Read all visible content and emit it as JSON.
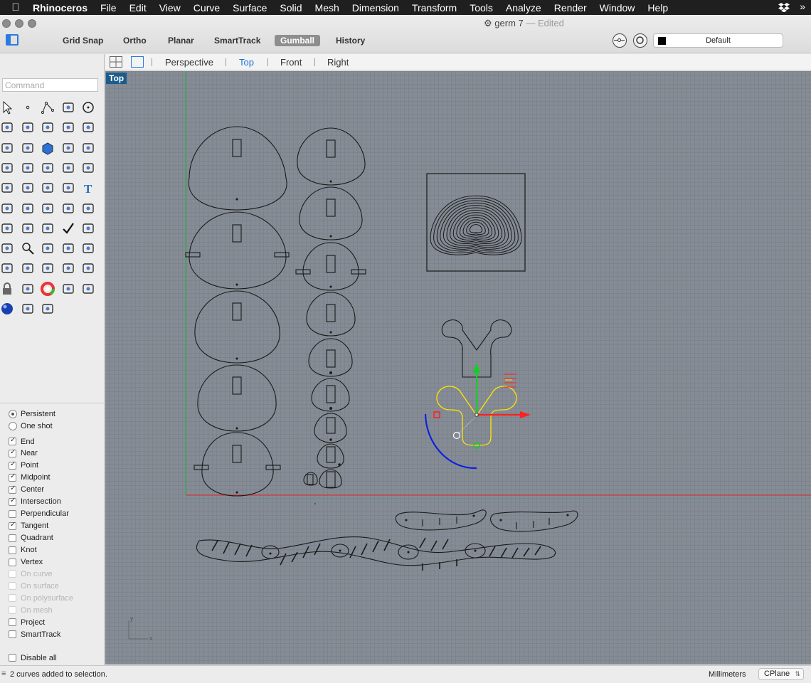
{
  "menubar": {
    "app": "Rhinoceros",
    "items": [
      "File",
      "Edit",
      "View",
      "Curve",
      "Surface",
      "Solid",
      "Mesh",
      "Dimension",
      "Transform",
      "Tools",
      "Analyze",
      "Render",
      "Window",
      "Help"
    ]
  },
  "window": {
    "title": "germ 7",
    "edited": "— Edited"
  },
  "toolbar": {
    "modes": [
      {
        "label": "Grid Snap",
        "active": false
      },
      {
        "label": "Ortho",
        "active": false
      },
      {
        "label": "Planar",
        "active": false
      },
      {
        "label": "SmartTrack",
        "active": false
      },
      {
        "label": "Gumball",
        "active": true
      },
      {
        "label": "History",
        "active": false
      }
    ],
    "layer": "Default"
  },
  "viewtabs": {
    "tabs": [
      "Perspective",
      "Top",
      "Front",
      "Right"
    ],
    "active": "Top"
  },
  "command": {
    "placeholder": "Command"
  },
  "viewport": {
    "label": "Top",
    "axis_x": "x",
    "axis_y": "y"
  },
  "osnap": {
    "modes": [
      {
        "label": "Persistent",
        "type": "radio",
        "on": true
      },
      {
        "label": "One shot",
        "type": "radio",
        "on": false
      }
    ],
    "items": [
      {
        "label": "End",
        "on": true,
        "enabled": true
      },
      {
        "label": "Near",
        "on": true,
        "enabled": true
      },
      {
        "label": "Point",
        "on": true,
        "enabled": true
      },
      {
        "label": "Midpoint",
        "on": true,
        "enabled": true
      },
      {
        "label": "Center",
        "on": true,
        "enabled": true
      },
      {
        "label": "Intersection",
        "on": true,
        "enabled": true
      },
      {
        "label": "Perpendicular",
        "on": false,
        "enabled": true
      },
      {
        "label": "Tangent",
        "on": true,
        "enabled": true
      },
      {
        "label": "Quadrant",
        "on": false,
        "enabled": true
      },
      {
        "label": "Knot",
        "on": false,
        "enabled": true
      },
      {
        "label": "Vertex",
        "on": false,
        "enabled": true
      },
      {
        "label": "On curve",
        "on": false,
        "enabled": false
      },
      {
        "label": "On surface",
        "on": false,
        "enabled": false
      },
      {
        "label": "On polysurface",
        "on": false,
        "enabled": false
      },
      {
        "label": "On mesh",
        "on": false,
        "enabled": false
      },
      {
        "label": "Project",
        "on": false,
        "enabled": true
      },
      {
        "label": "SmartTrack",
        "on": false,
        "enabled": true
      }
    ],
    "disable_all": "Disable all"
  },
  "status": {
    "message": "2 curves added to selection.",
    "units": "Millimeters",
    "cplane": "CPlane"
  },
  "colors": {
    "viewport_bg": "#858c95",
    "selection": "#ffe600",
    "x_axis": "#d23a3a",
    "y_axis": "#2bb04a",
    "gumball_x": "#ff2020",
    "gumball_y": "#10d020",
    "gumball_arc": "#1020e0",
    "active_tab": "#1a73d9",
    "viewport_label_bg": "#1c5c8c"
  }
}
